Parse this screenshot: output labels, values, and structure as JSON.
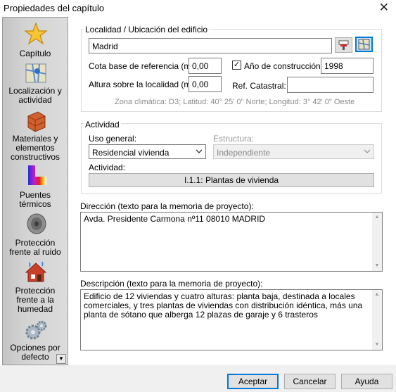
{
  "window": {
    "title": "Propiedades del capítulo",
    "close_glyph": "✕"
  },
  "sidebar": {
    "items": [
      {
        "label1": "Capítulo",
        "label2": "",
        "label3": "",
        "icon": "star-icon"
      },
      {
        "label1": "Localización y",
        "label2": "actividad",
        "label3": "",
        "icon": "map-icon"
      },
      {
        "label1": "Materiales y",
        "label2": "elementos",
        "label3": "constructivos",
        "icon": "bricks-icon"
      },
      {
        "label1": "Puentes",
        "label2": "térmicos",
        "label3": "",
        "icon": "thermal-bridge-icon"
      },
      {
        "label1": "Protección",
        "label2": "frente al ruido",
        "label3": "",
        "icon": "speaker-icon"
      },
      {
        "label1": "Protección",
        "label2": "frente a la",
        "label3": "humedad",
        "icon": "house-moisture-icon"
      },
      {
        "label1": "Opciones por",
        "label2": "defecto",
        "label3": "",
        "icon": "gears-icon"
      }
    ],
    "scroll_glyph": "▼"
  },
  "location": {
    "group_title": "Localidad / Ubicación del edificio",
    "locality_value": "Madrid",
    "cota_label": "Cota base de referencia (m):",
    "cota_value": "0,00",
    "year_checkbox_label": "Año de construcción:",
    "year_checked_glyph": "✓",
    "year_value": "1998",
    "altura_label": "Altura sobre la localidad (m):",
    "altura_value": "0,00",
    "catastral_label": "Ref. Catastral:",
    "catastral_value": "",
    "climate_zone_text": "Zona climática: D3; Latitud: 40° 25' 0\" Norte; Longitud: 3° 42' 0\" Oeste"
  },
  "activity": {
    "group_title": "Actividad",
    "uso_label": "Uso general:",
    "uso_value": "Residencial vivienda",
    "estructura_label": "Estructura:",
    "estructura_value": "Independiente",
    "actividad_label": "Actividad:",
    "actividad_button": "I.1.1: Plantas de vivienda"
  },
  "direccion": {
    "label": "Dirección (texto para la memoria de proyecto):",
    "value": "Avda. Presidente Carmona nº11 08010 MADRID"
  },
  "descripcion": {
    "label": "Descripción (texto para la memoria de proyecto):",
    "value": "Edificio de 12 viviendas y cuatro alturas: planta baja, destinada a locales comerciales, y tres plantas de viviendas con distribución idéntica, más una planta de sótano que alberga 12 plazas de garaje y 6 trasteros"
  },
  "buttons": {
    "accept": "Aceptar",
    "cancel": "Cancelar",
    "help": "Ayuda"
  }
}
